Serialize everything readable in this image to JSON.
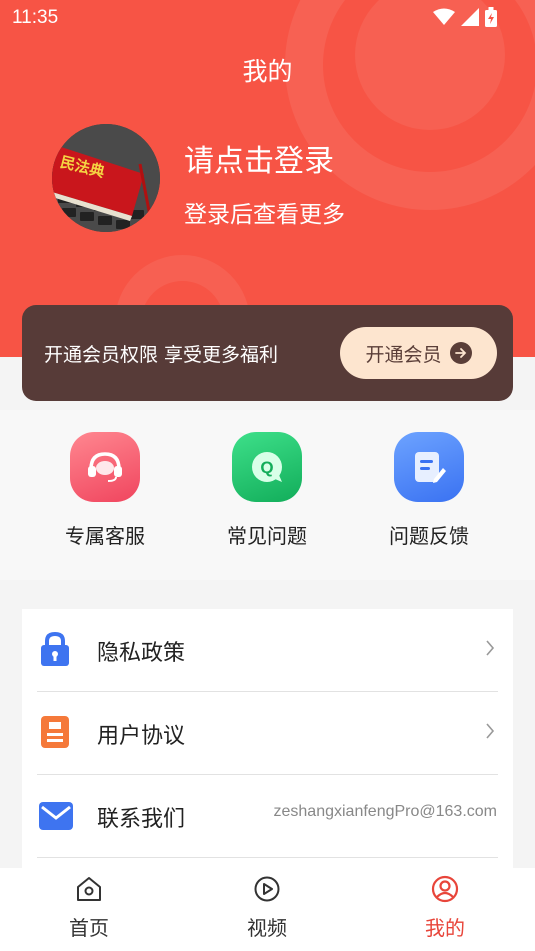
{
  "status_bar": {
    "time": "11:35"
  },
  "header": {
    "title": "我的",
    "login_title": "请点击登录",
    "login_subtitle": "登录后查看更多",
    "avatar_book_label": "民法典"
  },
  "vip_banner": {
    "text": "开通会员权限 享受更多福利",
    "button_label": "开通会员"
  },
  "quick_actions": [
    {
      "label": "专属客服",
      "icon": "headset-icon",
      "color": "#f0566a"
    },
    {
      "label": "常见问题",
      "icon": "question-icon",
      "color": "#22c06a"
    },
    {
      "label": "问题反馈",
      "icon": "feedback-icon",
      "color": "#3d7ef5"
    }
  ],
  "menu": [
    {
      "label": "隐私政策",
      "icon": "lock-icon",
      "color": "#3e74f0"
    },
    {
      "label": "用户协议",
      "icon": "document-icon",
      "color": "#f5793a"
    },
    {
      "label": "联系我们",
      "icon": "mail-icon",
      "color": "#3e74f0",
      "value": "zeshangxianfengPro@163.com"
    }
  ],
  "tab_bar": [
    {
      "label": "首页",
      "icon": "home-icon"
    },
    {
      "label": "视频",
      "icon": "video-icon"
    },
    {
      "label": "我的",
      "icon": "profile-icon",
      "active": true
    }
  ],
  "colors": {
    "header_bg": "#f75445",
    "vip_bg": "#573b38",
    "vip_button": "#fde5cf",
    "active_tab": "#e8453a"
  }
}
